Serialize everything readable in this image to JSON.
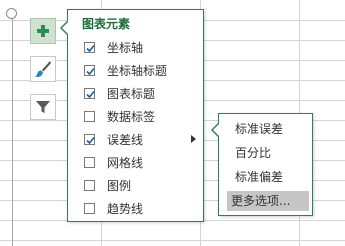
{
  "chart_elements_panel": {
    "title": "图表元素",
    "items": [
      {
        "label": "坐标轴",
        "checked": true
      },
      {
        "label": "坐标轴标题",
        "checked": true
      },
      {
        "label": "图表标题",
        "checked": true
      },
      {
        "label": "数据标签",
        "checked": false
      },
      {
        "label": "误差线",
        "checked": true,
        "has_submenu": true
      },
      {
        "label": "网格线",
        "checked": false
      },
      {
        "label": "图例",
        "checked": false
      },
      {
        "label": "趋势线",
        "checked": false
      }
    ]
  },
  "error_bars_submenu": {
    "items": [
      "标准误差",
      "百分比",
      "标准偏差",
      "更多选项..."
    ],
    "highlighted": "更多选项..."
  },
  "tool_buttons": [
    {
      "icon": "plus-icon",
      "active": true
    },
    {
      "icon": "brush-icon",
      "active": false
    },
    {
      "icon": "filter-icon",
      "active": false
    }
  ],
  "colors": {
    "accent": "#2d7f4f",
    "title": "#1e6b3c",
    "highlight": "#c6c6c6",
    "gridline": "#d4d4d4"
  }
}
